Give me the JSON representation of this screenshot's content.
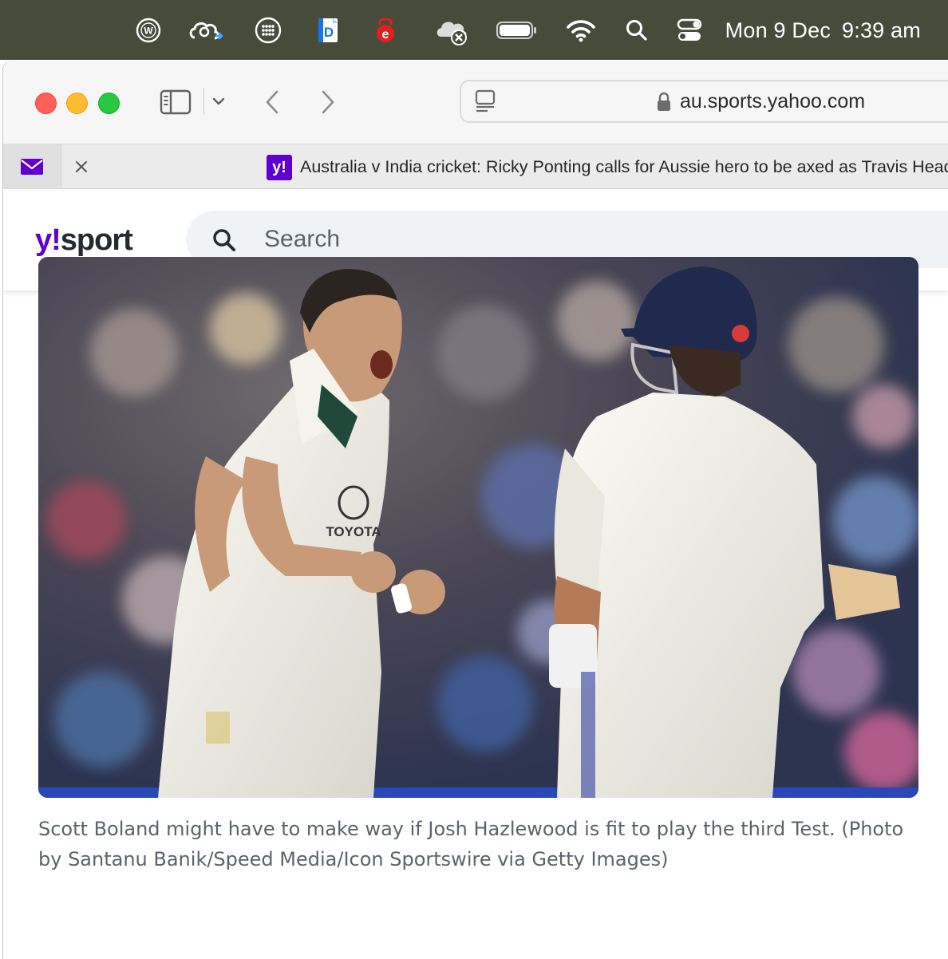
{
  "menubar": {
    "icons": [
      "wordpress-icon",
      "cloud-sync-icon",
      "grid-menu-icon",
      "document-app-icon",
      "edge-e-icon",
      "icloud-offline-icon",
      "battery-icon",
      "wifi-icon",
      "spotlight-search-icon",
      "control-center-icon"
    ],
    "date": "Mon 9 Dec",
    "time": "9:39 am"
  },
  "browser": {
    "address": "au.sports.yahoo.com",
    "tab": {
      "favicon": "y!",
      "title": "Australia v India cricket: Ricky Ponting calls for Aussie hero to be axed as Travis Head"
    }
  },
  "site": {
    "logo_y": "y!",
    "logo_sport": "sport",
    "search_placeholder": "Search"
  },
  "article": {
    "image_caption": "Scott Boland might have to make way if Josh Hazlewood is fit to play the third Test. (Photo by Santanu Banik/Speed Media/Icon Sportswire via Getty Images)"
  },
  "colors": {
    "menubar_bg": "#474c3a",
    "yahoo_purple": "#6001d2",
    "text_dark": "#232a31",
    "caption_text": "#5b636a"
  }
}
